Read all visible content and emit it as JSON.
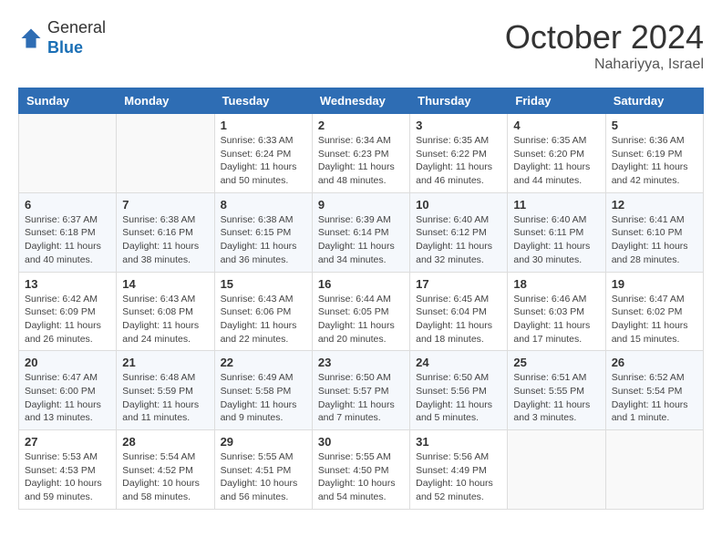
{
  "header": {
    "logo_line1": "General",
    "logo_line2": "Blue",
    "month": "October 2024",
    "location": "Nahariyya, Israel"
  },
  "days_of_week": [
    "Sunday",
    "Monday",
    "Tuesday",
    "Wednesday",
    "Thursday",
    "Friday",
    "Saturday"
  ],
  "weeks": [
    [
      {
        "day": "",
        "info": ""
      },
      {
        "day": "",
        "info": ""
      },
      {
        "day": "1",
        "info": "Sunrise: 6:33 AM\nSunset: 6:24 PM\nDaylight: 11 hours and 50 minutes."
      },
      {
        "day": "2",
        "info": "Sunrise: 6:34 AM\nSunset: 6:23 PM\nDaylight: 11 hours and 48 minutes."
      },
      {
        "day": "3",
        "info": "Sunrise: 6:35 AM\nSunset: 6:22 PM\nDaylight: 11 hours and 46 minutes."
      },
      {
        "day": "4",
        "info": "Sunrise: 6:35 AM\nSunset: 6:20 PM\nDaylight: 11 hours and 44 minutes."
      },
      {
        "day": "5",
        "info": "Sunrise: 6:36 AM\nSunset: 6:19 PM\nDaylight: 11 hours and 42 minutes."
      }
    ],
    [
      {
        "day": "6",
        "info": "Sunrise: 6:37 AM\nSunset: 6:18 PM\nDaylight: 11 hours and 40 minutes."
      },
      {
        "day": "7",
        "info": "Sunrise: 6:38 AM\nSunset: 6:16 PM\nDaylight: 11 hours and 38 minutes."
      },
      {
        "day": "8",
        "info": "Sunrise: 6:38 AM\nSunset: 6:15 PM\nDaylight: 11 hours and 36 minutes."
      },
      {
        "day": "9",
        "info": "Sunrise: 6:39 AM\nSunset: 6:14 PM\nDaylight: 11 hours and 34 minutes."
      },
      {
        "day": "10",
        "info": "Sunrise: 6:40 AM\nSunset: 6:12 PM\nDaylight: 11 hours and 32 minutes."
      },
      {
        "day": "11",
        "info": "Sunrise: 6:40 AM\nSunset: 6:11 PM\nDaylight: 11 hours and 30 minutes."
      },
      {
        "day": "12",
        "info": "Sunrise: 6:41 AM\nSunset: 6:10 PM\nDaylight: 11 hours and 28 minutes."
      }
    ],
    [
      {
        "day": "13",
        "info": "Sunrise: 6:42 AM\nSunset: 6:09 PM\nDaylight: 11 hours and 26 minutes."
      },
      {
        "day": "14",
        "info": "Sunrise: 6:43 AM\nSunset: 6:08 PM\nDaylight: 11 hours and 24 minutes."
      },
      {
        "day": "15",
        "info": "Sunrise: 6:43 AM\nSunset: 6:06 PM\nDaylight: 11 hours and 22 minutes."
      },
      {
        "day": "16",
        "info": "Sunrise: 6:44 AM\nSunset: 6:05 PM\nDaylight: 11 hours and 20 minutes."
      },
      {
        "day": "17",
        "info": "Sunrise: 6:45 AM\nSunset: 6:04 PM\nDaylight: 11 hours and 18 minutes."
      },
      {
        "day": "18",
        "info": "Sunrise: 6:46 AM\nSunset: 6:03 PM\nDaylight: 11 hours and 17 minutes."
      },
      {
        "day": "19",
        "info": "Sunrise: 6:47 AM\nSunset: 6:02 PM\nDaylight: 11 hours and 15 minutes."
      }
    ],
    [
      {
        "day": "20",
        "info": "Sunrise: 6:47 AM\nSunset: 6:00 PM\nDaylight: 11 hours and 13 minutes."
      },
      {
        "day": "21",
        "info": "Sunrise: 6:48 AM\nSunset: 5:59 PM\nDaylight: 11 hours and 11 minutes."
      },
      {
        "day": "22",
        "info": "Sunrise: 6:49 AM\nSunset: 5:58 PM\nDaylight: 11 hours and 9 minutes."
      },
      {
        "day": "23",
        "info": "Sunrise: 6:50 AM\nSunset: 5:57 PM\nDaylight: 11 hours and 7 minutes."
      },
      {
        "day": "24",
        "info": "Sunrise: 6:50 AM\nSunset: 5:56 PM\nDaylight: 11 hours and 5 minutes."
      },
      {
        "day": "25",
        "info": "Sunrise: 6:51 AM\nSunset: 5:55 PM\nDaylight: 11 hours and 3 minutes."
      },
      {
        "day": "26",
        "info": "Sunrise: 6:52 AM\nSunset: 5:54 PM\nDaylight: 11 hours and 1 minute."
      }
    ],
    [
      {
        "day": "27",
        "info": "Sunrise: 5:53 AM\nSunset: 4:53 PM\nDaylight: 10 hours and 59 minutes."
      },
      {
        "day": "28",
        "info": "Sunrise: 5:54 AM\nSunset: 4:52 PM\nDaylight: 10 hours and 58 minutes."
      },
      {
        "day": "29",
        "info": "Sunrise: 5:55 AM\nSunset: 4:51 PM\nDaylight: 10 hours and 56 minutes."
      },
      {
        "day": "30",
        "info": "Sunrise: 5:55 AM\nSunset: 4:50 PM\nDaylight: 10 hours and 54 minutes."
      },
      {
        "day": "31",
        "info": "Sunrise: 5:56 AM\nSunset: 4:49 PM\nDaylight: 10 hours and 52 minutes."
      },
      {
        "day": "",
        "info": ""
      },
      {
        "day": "",
        "info": ""
      }
    ]
  ]
}
